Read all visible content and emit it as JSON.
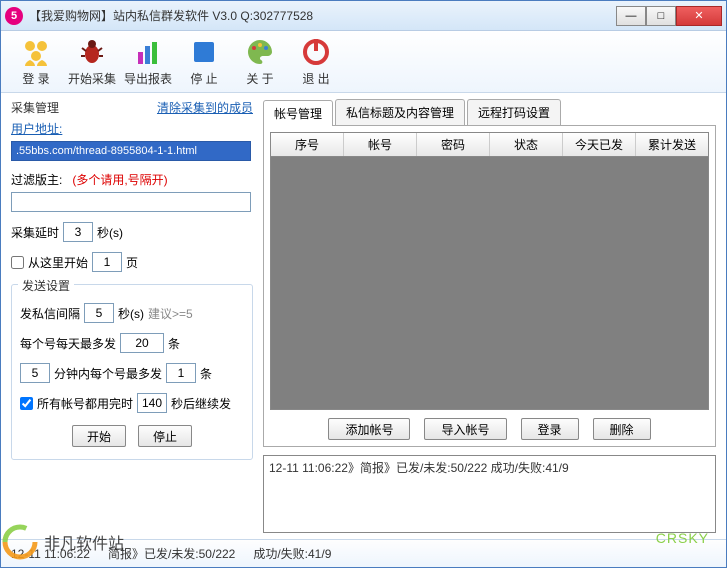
{
  "title": "【我爱购物网】站内私信群发软件  V3.0   Q:302777528",
  "toolbar": {
    "login": "登 录",
    "start_collect": "开始采集",
    "export": "导出报表",
    "stop": "停 止",
    "about": "关 于",
    "exit": "退 出"
  },
  "collect": {
    "title": "采集管理",
    "clear_link": "清除采集到的成员",
    "user_addr": "用户地址:",
    "url_value": ".55bbs.com/thread-8955804-1-1.html",
    "filter_label": "过滤版主:",
    "filter_hint": "(多个请用,号隔开)",
    "filter_value": "",
    "delay_label": "采集延时",
    "delay_value": "3",
    "seconds": "秒(s)",
    "from_here": "从这里开始",
    "page_value": "1",
    "page_unit": "页"
  },
  "send": {
    "legend": "发送设置",
    "interval_label": "发私信间隔",
    "interval_value": "5",
    "interval_unit": "秒(s)",
    "interval_hint": "建议>=5",
    "per_day_label": "每个号每天最多发",
    "per_day_value": "20",
    "count_unit": "条",
    "per_min_pre": "5",
    "per_min_label": "分钟内每个号最多发",
    "per_min_value": "1",
    "all_done_label": "所有帐号都用完时",
    "all_done_value": "140",
    "all_done_unit": "秒后继续发",
    "start_btn": "开始",
    "stop_btn": "停止"
  },
  "tabs": {
    "account": "帐号管理",
    "title_content": "私信标题及内容管理",
    "remote": "远程打码设置"
  },
  "grid": {
    "cols": [
      "序号",
      "帐号",
      "密码",
      "状态",
      "今天已发",
      "累计发送"
    ]
  },
  "account_btns": {
    "add": "添加帐号",
    "import": "导入帐号",
    "login": "登录",
    "delete": "删除"
  },
  "log": "12-11 11:06:22》简报》已发/未发:50/222      成功/失败:41/9",
  "status": {
    "time": "12-11 11:06:22",
    "brief": "简报》已发/未发:50/222",
    "result": "成功/失败:41/9"
  },
  "watermark": {
    "text": "非凡软件站",
    "sub": "CRSKY"
  }
}
